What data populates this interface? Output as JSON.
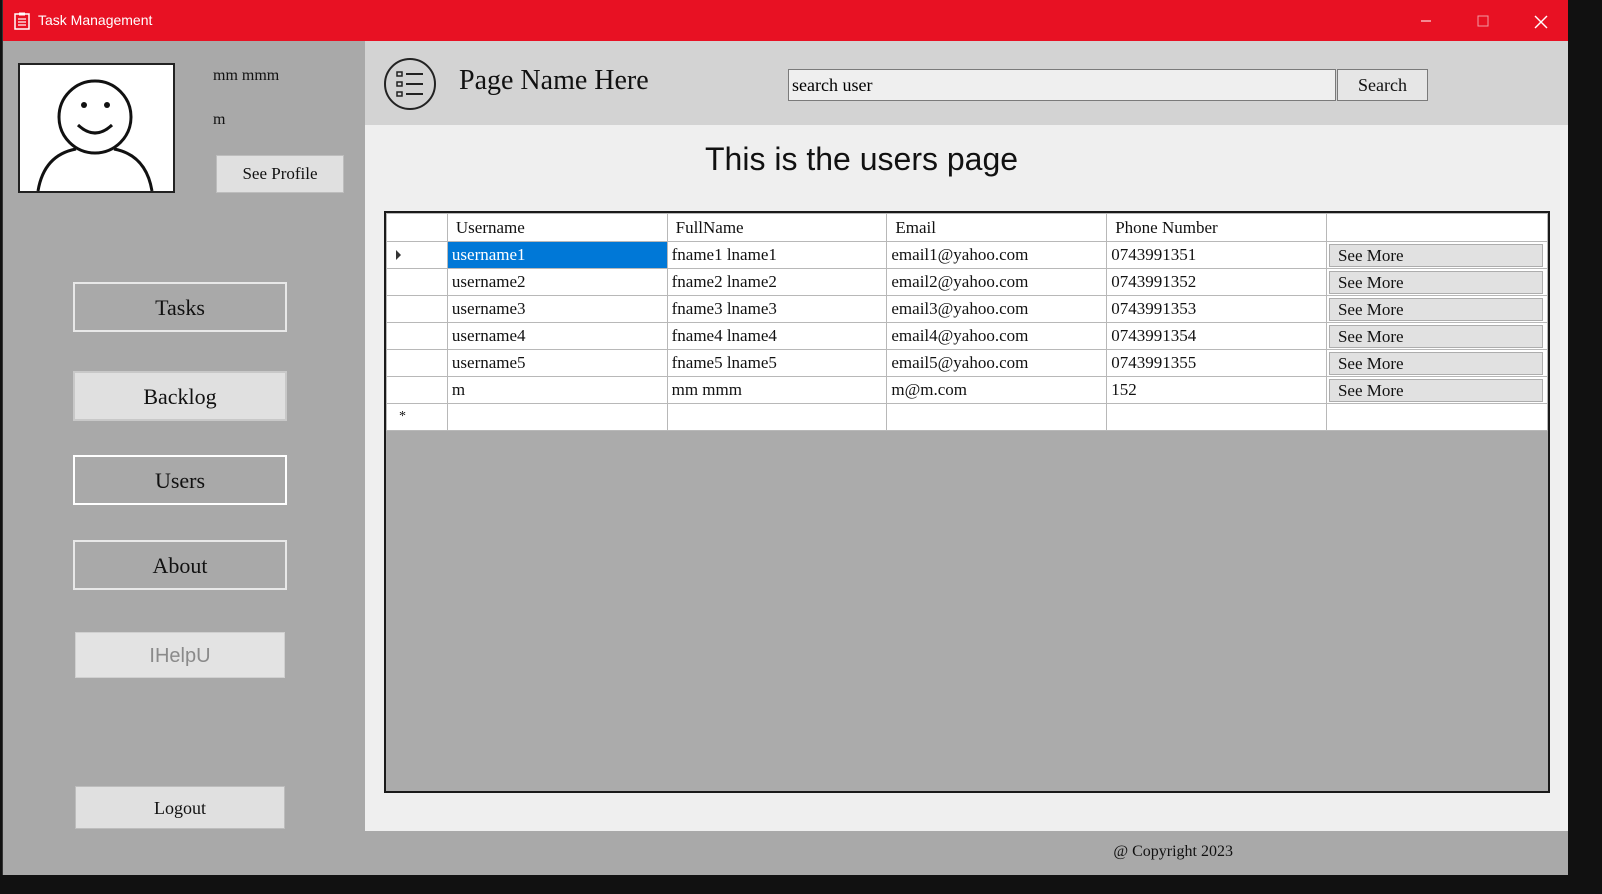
{
  "window": {
    "title": "Task Management"
  },
  "sidebar": {
    "user_fullname": "mm mmm",
    "user_username": "m",
    "see_profile_label": "See Profile",
    "nav": {
      "tasks": "Tasks",
      "backlog": "Backlog",
      "users": "Users",
      "about": "About"
    },
    "ihelpu_label": "IHelpU",
    "logout_label": "Logout"
  },
  "header": {
    "page_name": "Page Name Here",
    "search_value": "search user",
    "search_button": "Search"
  },
  "main": {
    "heading": "This is the users page",
    "table": {
      "columns": [
        "Username",
        "FullName",
        "Email",
        "Phone Number",
        ""
      ],
      "rows": [
        {
          "username": "username1",
          "fullname": "fname1 lname1",
          "email": "email1@yahoo.com",
          "phone": "0743991351",
          "action": "See More"
        },
        {
          "username": "username2",
          "fullname": "fname2 lname2",
          "email": "email2@yahoo.com",
          "phone": "0743991352",
          "action": "See More"
        },
        {
          "username": "username3",
          "fullname": "fname3 lname3",
          "email": "email3@yahoo.com",
          "phone": "0743991353",
          "action": "See More"
        },
        {
          "username": "username4",
          "fullname": "fname4 lname4",
          "email": "email4@yahoo.com",
          "phone": "0743991354",
          "action": "See More"
        },
        {
          "username": "username5",
          "fullname": "fname5 lname5",
          "email": "email5@yahoo.com",
          "phone": "0743991355",
          "action": "See More"
        },
        {
          "username": "m",
          "fullname": "mm mmm",
          "email": "m@m.com",
          "phone": "152",
          "action": "See More"
        }
      ],
      "new_row_marker": "*"
    }
  },
  "footer": {
    "copyright": "@ Copyright 2023"
  },
  "colors": {
    "titlebar": "#e81123",
    "sidebar": "#a9a9a9",
    "header": "#d3d3d3",
    "content": "#efefef",
    "selection": "#0078d7"
  }
}
